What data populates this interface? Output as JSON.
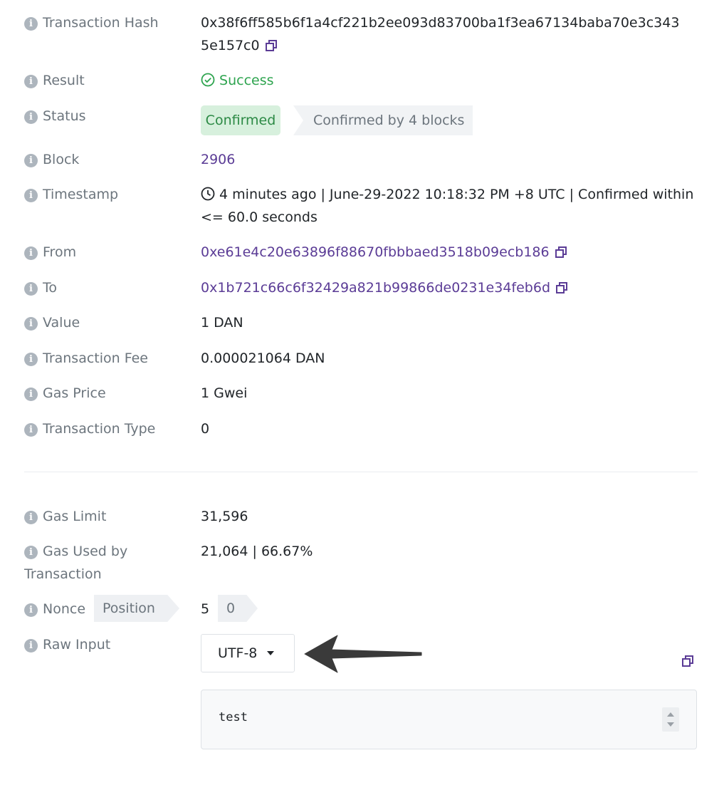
{
  "labels": {
    "tx_hash": "Transaction Hash",
    "result": "Result",
    "status": "Status",
    "block": "Block",
    "timestamp": "Timestamp",
    "from": "From",
    "to": "To",
    "value": "Value",
    "tx_fee": "Transaction Fee",
    "gas_price": "Gas Price",
    "tx_type": "Transaction Type",
    "gas_limit": "Gas Limit",
    "gas_used_1": "Gas Used by",
    "gas_used_2": "Transaction",
    "nonce": "Nonce",
    "position": "Position",
    "raw_input": "Raw Input"
  },
  "values": {
    "tx_hash_line1": "0x38f6ff585b6f1a4cf221b2ee093d83700ba1f3ea67134baba70e3c343",
    "tx_hash_line2": "5e157c0",
    "result": "Success",
    "status_badge": "Confirmed",
    "status_blocks": "Confirmed by 4 blocks",
    "block": "2906",
    "timestamp_line1": "4 minutes ago | June-29-2022 10:18:32 PM +8 UTC | Confirmed within",
    "timestamp_line2": "<= 60.0 seconds",
    "from": "0xe61e4c20e63896f88670fbbbaed3518b09ecb186",
    "to": "0x1b721c66c6f32429a821b99866de0231e34feb6d",
    "value": "1 DAN",
    "tx_fee": "0.000021064 DAN",
    "gas_price": "1 Gwei",
    "tx_type": "0",
    "gas_limit": "31,596",
    "gas_used": "21,064 | 66.67%",
    "nonce": "5",
    "position": "0",
    "encoding": "UTF-8",
    "raw_input": "test"
  },
  "icons": {
    "info": "info-circle-icon",
    "copy": "copy-icon",
    "success": "check-circle-icon",
    "clock": "clock-icon",
    "caret": "caret-down-icon",
    "arrow": "arrow-left-annotation"
  },
  "colors": {
    "link": "#5b3c96",
    "success": "#2ea44f",
    "confirmed_bg": "#d7f0dd",
    "muted": "#6c757d"
  }
}
